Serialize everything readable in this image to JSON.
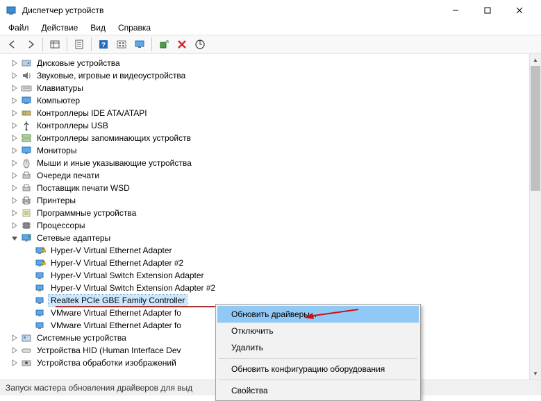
{
  "titlebar": {
    "title": "Диспетчер устройств"
  },
  "menubar": {
    "items": [
      "Файл",
      "Действие",
      "Вид",
      "Справка"
    ]
  },
  "toolbar": {
    "buttons": [
      {
        "name": "back-icon"
      },
      {
        "name": "forward-icon"
      },
      {
        "sep": true
      },
      {
        "name": "show-hidden-icon"
      },
      {
        "sep": true
      },
      {
        "name": "properties-icon"
      },
      {
        "sep": true
      },
      {
        "name": "help-icon"
      },
      {
        "name": "view1-icon"
      },
      {
        "name": "view2-icon"
      },
      {
        "sep": true
      },
      {
        "name": "scan-hardware-icon"
      },
      {
        "name": "remove-icon"
      },
      {
        "name": "update-driver-icon"
      }
    ]
  },
  "tree": {
    "categories": [
      {
        "label": "Дисковые устройства",
        "icon": "disk"
      },
      {
        "label": "Звуковые, игровые и видеоустройства",
        "icon": "audio"
      },
      {
        "label": "Клавиатуры",
        "icon": "keyboard"
      },
      {
        "label": "Компьютер",
        "icon": "computer"
      },
      {
        "label": "Контроллеры IDE ATA/ATAPI",
        "icon": "ide"
      },
      {
        "label": "Контроллеры USB",
        "icon": "usb"
      },
      {
        "label": "Контроллеры запоминающих устройств",
        "icon": "storage"
      },
      {
        "label": "Мониторы",
        "icon": "monitor"
      },
      {
        "label": "Мыши и иные указывающие устройства",
        "icon": "mouse"
      },
      {
        "label": "Очереди печати",
        "icon": "print-queue"
      },
      {
        "label": "Поставщик печати WSD",
        "icon": "print-queue"
      },
      {
        "label": "Принтеры",
        "icon": "printer"
      },
      {
        "label": "Программные устройства",
        "icon": "software"
      },
      {
        "label": "Процессоры",
        "icon": "cpu"
      }
    ],
    "network": {
      "label": "Сетевые адаптеры",
      "children": [
        {
          "label": "Hyper-V Virtual Ethernet Adapter",
          "warn": true
        },
        {
          "label": "Hyper-V Virtual Ethernet Adapter #2",
          "warn": true
        },
        {
          "label": "Hyper-V Virtual Switch Extension Adapter",
          "warn": false
        },
        {
          "label": "Hyper-V Virtual Switch Extension Adapter #2",
          "warn": false
        },
        {
          "label": "Realtek PCIe GBE Family Controller",
          "warn": false,
          "selected": true
        },
        {
          "label": "VMware Virtual Ethernet Adapter fo",
          "warn": false
        },
        {
          "label": "VMware Virtual Ethernet Adapter fo",
          "warn": false
        }
      ]
    },
    "after": [
      {
        "label": "Системные устройства",
        "icon": "system"
      },
      {
        "label": "Устройства HID (Human Interface Dev",
        "icon": "hid"
      },
      {
        "label": "Устройства обработки изображений",
        "icon": "imaging"
      }
    ]
  },
  "context_menu": {
    "items": [
      {
        "label": "Обновить драйверы...",
        "highlight": true
      },
      {
        "label": "Отключить"
      },
      {
        "label": "Удалить"
      },
      {
        "sep": true
      },
      {
        "label": "Обновить конфигурацию оборудования"
      },
      {
        "sep": true
      },
      {
        "label": "Свойства"
      }
    ]
  },
  "statusbar": {
    "text": "Запуск мастера обновления драйверов для выд"
  }
}
